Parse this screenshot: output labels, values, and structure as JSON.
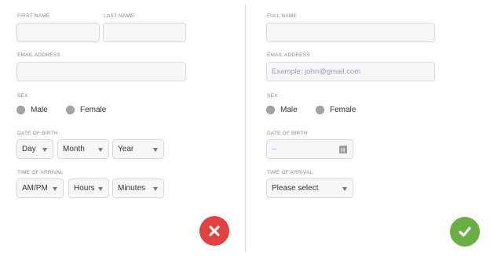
{
  "left_form": {
    "first_name_label": "FIRST NAME",
    "last_name_label": "LAST NAME",
    "email_label": "EMAIL ADDRESS",
    "sex_label": "SEX",
    "sex_options": [
      "Male",
      "Female"
    ],
    "dob_label": "DATE OF BIRTH",
    "dob_selects": [
      "Day",
      "Month",
      "Year"
    ],
    "arrival_label": "TIME OF ARRIVAL",
    "arrival_selects": [
      "AM/PM",
      "Hours",
      "Minutes"
    ]
  },
  "right_form": {
    "full_name_label": "FULL NAME",
    "email_label": "EMAIL ADDRESS",
    "email_placeholder": "Example: john@gmail.com",
    "sex_label": "SEX",
    "sex_options": [
      "Male",
      "Female"
    ],
    "dob_label": "DATE OF BIRTH",
    "dob_value": "--",
    "arrival_label": "TIME OF ARRIVAL",
    "arrival_select": "Please select"
  },
  "icons": {
    "cancel": "close-icon",
    "confirm": "check-icon",
    "calendar": "calendar-icon",
    "dropdown": "chevron-down-icon"
  },
  "colors": {
    "cancel_button": "#e3413f",
    "confirm_button": "#6aaf45",
    "field_background": "#f6f7f8",
    "field_border": "#d6dadd",
    "radio": "#a4a4a4"
  }
}
